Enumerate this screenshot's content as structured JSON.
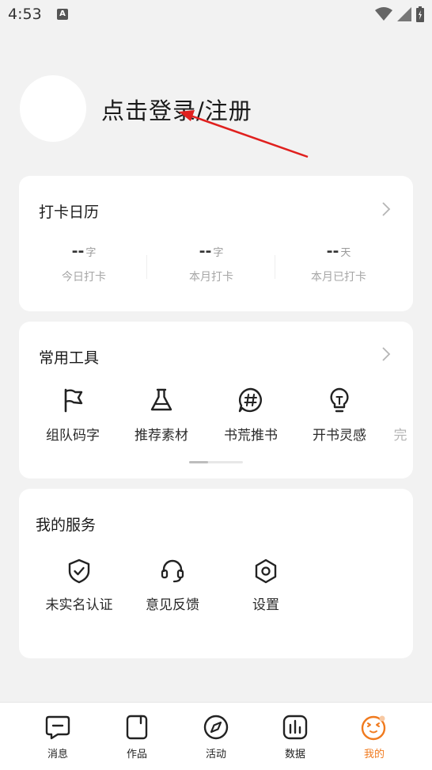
{
  "status_bar": {
    "time": "4:53",
    "notification_icon": "A"
  },
  "profile": {
    "login_text": "点击登录/注册"
  },
  "calendar": {
    "title": "打卡日历",
    "stats": [
      {
        "value": "--",
        "unit": "字",
        "label": "今日打卡"
      },
      {
        "value": "--",
        "unit": "字",
        "label": "本月打卡"
      },
      {
        "value": "--",
        "unit": "天",
        "label": "本月已打卡"
      }
    ]
  },
  "tools": {
    "title": "常用工具",
    "items": [
      {
        "label": "组队码字",
        "icon": "flag-icon"
      },
      {
        "label": "推荐素材",
        "icon": "flask-icon"
      },
      {
        "label": "书荒推书",
        "icon": "hashtag-chat-icon"
      },
      {
        "label": "开书灵感",
        "icon": "lightbulb-icon"
      },
      {
        "label": "完",
        "icon": "partial-icon"
      }
    ]
  },
  "services": {
    "title": "我的服务",
    "items": [
      {
        "label": "未实名认证",
        "icon": "shield-check-icon"
      },
      {
        "label": "意见反馈",
        "icon": "headset-icon"
      },
      {
        "label": "设置",
        "icon": "settings-hex-icon"
      }
    ]
  },
  "bottom_nav": {
    "items": [
      {
        "label": "消息",
        "icon": "message-icon"
      },
      {
        "label": "作品",
        "icon": "book-icon"
      },
      {
        "label": "活动",
        "icon": "compass-icon"
      },
      {
        "label": "数据",
        "icon": "chart-icon"
      },
      {
        "label": "我的",
        "icon": "face-icon"
      }
    ],
    "active_index": 4,
    "active_color": "#f07a1e"
  },
  "annotation_color": "#e0201e"
}
